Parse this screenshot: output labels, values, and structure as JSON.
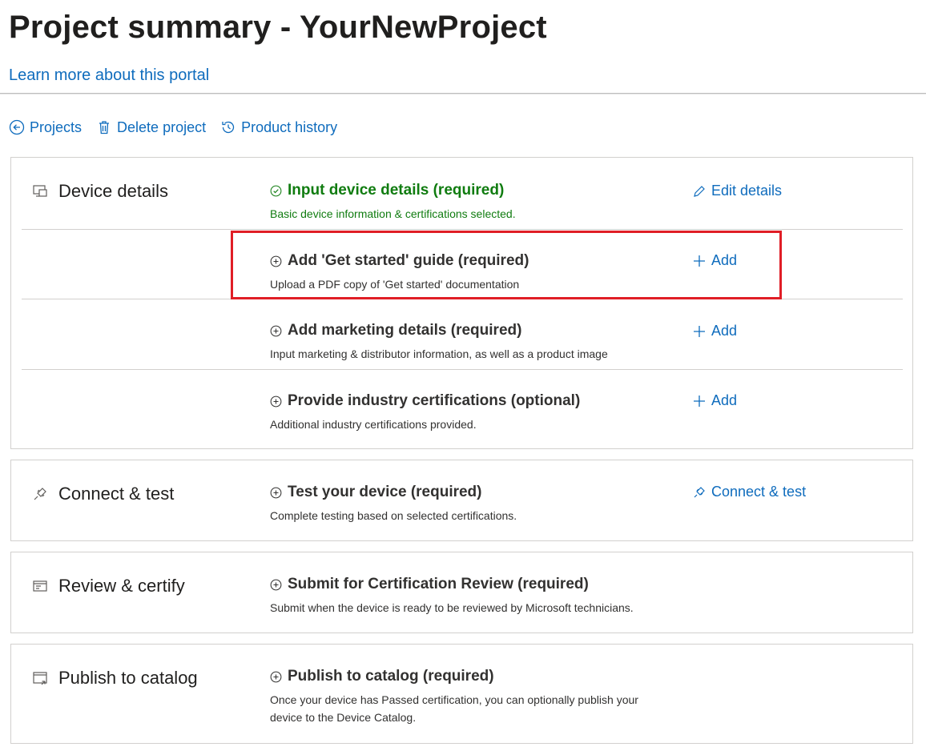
{
  "header": {
    "title": "Project summary - YourNewProject",
    "learn_link": "Learn more about this portal"
  },
  "commands": [
    {
      "label": "Projects",
      "icon": "back-circle-icon"
    },
    {
      "label": "Delete project",
      "icon": "trash-icon"
    },
    {
      "label": "Product history",
      "icon": "history-icon"
    }
  ],
  "sections": [
    {
      "title": "Device details",
      "icon": "device-icon",
      "tasks": [
        {
          "title": "Input device details (required)",
          "desc": "Basic device information & certifications selected.",
          "status": "complete",
          "action": "Edit details",
          "action_icon": "pencil-icon"
        },
        {
          "title": "Add 'Get started' guide (required)",
          "desc": "Upload a PDF copy of 'Get started' documentation",
          "status": "pending",
          "action": "Add",
          "action_icon": "plus-icon"
        },
        {
          "title": "Add marketing details (required)",
          "desc": "Input marketing & distributor information, as well as a product image",
          "status": "pending",
          "action": "Add",
          "action_icon": "plus-icon"
        },
        {
          "title": "Provide industry certifications (optional)",
          "desc": "Additional industry certifications provided.",
          "status": "pending",
          "action": "Add",
          "action_icon": "plus-icon"
        }
      ]
    },
    {
      "title": "Connect & test",
      "icon": "plug-icon",
      "tasks": [
        {
          "title": "Test your device (required)",
          "desc": "Complete testing based on selected certifications.",
          "status": "pending",
          "action": "Connect & test",
          "action_icon": "plug-icon"
        }
      ]
    },
    {
      "title": "Review & certify",
      "icon": "certificate-icon",
      "tasks": [
        {
          "title": "Submit for Certification Review (required)",
          "desc": "Submit when the device is ready to be reviewed by Microsoft technicians.",
          "status": "pending"
        }
      ]
    },
    {
      "title": "Publish to catalog",
      "icon": "publish-icon",
      "tasks": [
        {
          "title": "Publish to catalog (required)",
          "desc": "Once your device has Passed certification, you can optionally publish your device to the Device Catalog.",
          "status": "pending"
        }
      ]
    }
  ],
  "colors": {
    "link": "#0f6cbd",
    "success": "#107c10",
    "highlight": "#e01e26",
    "border": "#d2d0ce"
  }
}
